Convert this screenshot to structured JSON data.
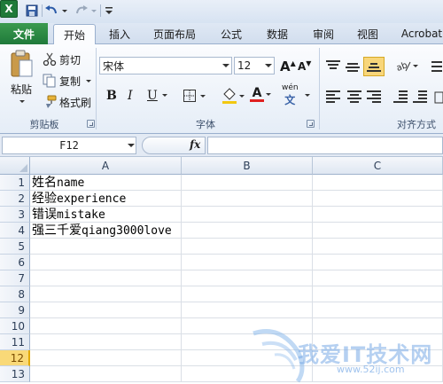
{
  "app": {
    "logo_letter": "X"
  },
  "tabs": [
    "文件",
    "开始",
    "插入",
    "页面布局",
    "公式",
    "数据",
    "审阅",
    "视图",
    "Acrobat"
  ],
  "ribbon": {
    "clipboard": {
      "paste": "粘贴",
      "cut": "剪切",
      "copy": "复制",
      "format_painter": "格式刷",
      "label": "剪贴板"
    },
    "font": {
      "name": "宋体",
      "size": "12",
      "grow": "A",
      "shrink": "A",
      "bold": "B",
      "italic": "I",
      "underline": "U",
      "font_color_letter": "A",
      "phonetic": "wén",
      "label": "字体"
    },
    "alignment": {
      "label": "对齐方式"
    }
  },
  "formula_bar": {
    "name_box": "F12",
    "fx": "fx",
    "value": ""
  },
  "grid": {
    "columns": [
      "A",
      "B",
      "C"
    ],
    "rows": [
      "1",
      "2",
      "3",
      "4",
      "5",
      "6",
      "7",
      "8",
      "9",
      "10",
      "11",
      "12",
      "13"
    ],
    "selected_row": "12",
    "cells": [
      {
        "cn": "姓名",
        "en": "name"
      },
      {
        "cn": "经验",
        "en": "experience"
      },
      {
        "cn": "错误",
        "en": "mistake"
      },
      {
        "cn": "强三千爱",
        "en": "qiang3000love"
      }
    ]
  },
  "watermark": {
    "text": "我爱IT技术网",
    "url": "www.52ij.com"
  },
  "colors": {
    "file_tab": "#1f7a3a",
    "highlight": "#f2c811",
    "font_color": "#e02020",
    "selected_row": "#f9d978"
  }
}
